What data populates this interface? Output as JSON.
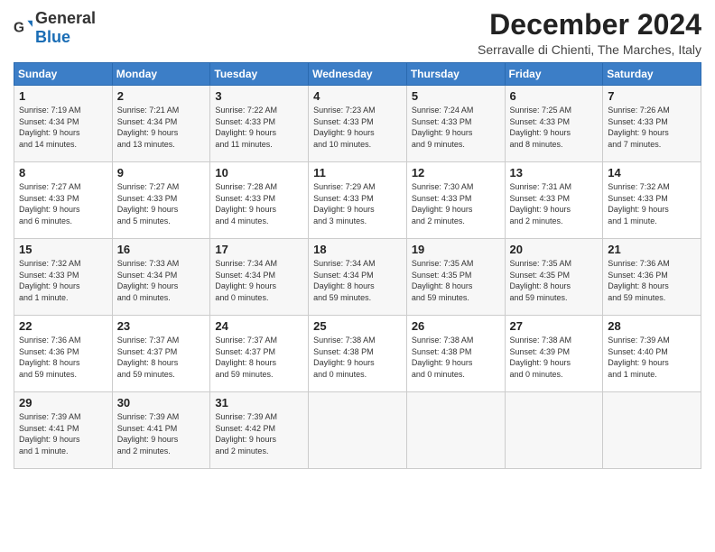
{
  "header": {
    "logo_general": "General",
    "logo_blue": "Blue",
    "title": "December 2024",
    "location": "Serravalle di Chienti, The Marches, Italy"
  },
  "days_of_week": [
    "Sunday",
    "Monday",
    "Tuesday",
    "Wednesday",
    "Thursday",
    "Friday",
    "Saturday"
  ],
  "weeks": [
    [
      {
        "day": 1,
        "info": "Sunrise: 7:19 AM\nSunset: 4:34 PM\nDaylight: 9 hours\nand 14 minutes."
      },
      {
        "day": 2,
        "info": "Sunrise: 7:21 AM\nSunset: 4:34 PM\nDaylight: 9 hours\nand 13 minutes."
      },
      {
        "day": 3,
        "info": "Sunrise: 7:22 AM\nSunset: 4:33 PM\nDaylight: 9 hours\nand 11 minutes."
      },
      {
        "day": 4,
        "info": "Sunrise: 7:23 AM\nSunset: 4:33 PM\nDaylight: 9 hours\nand 10 minutes."
      },
      {
        "day": 5,
        "info": "Sunrise: 7:24 AM\nSunset: 4:33 PM\nDaylight: 9 hours\nand 9 minutes."
      },
      {
        "day": 6,
        "info": "Sunrise: 7:25 AM\nSunset: 4:33 PM\nDaylight: 9 hours\nand 8 minutes."
      },
      {
        "day": 7,
        "info": "Sunrise: 7:26 AM\nSunset: 4:33 PM\nDaylight: 9 hours\nand 7 minutes."
      }
    ],
    [
      {
        "day": 8,
        "info": "Sunrise: 7:27 AM\nSunset: 4:33 PM\nDaylight: 9 hours\nand 6 minutes."
      },
      {
        "day": 9,
        "info": "Sunrise: 7:27 AM\nSunset: 4:33 PM\nDaylight: 9 hours\nand 5 minutes."
      },
      {
        "day": 10,
        "info": "Sunrise: 7:28 AM\nSunset: 4:33 PM\nDaylight: 9 hours\nand 4 minutes."
      },
      {
        "day": 11,
        "info": "Sunrise: 7:29 AM\nSunset: 4:33 PM\nDaylight: 9 hours\nand 3 minutes."
      },
      {
        "day": 12,
        "info": "Sunrise: 7:30 AM\nSunset: 4:33 PM\nDaylight: 9 hours\nand 2 minutes."
      },
      {
        "day": 13,
        "info": "Sunrise: 7:31 AM\nSunset: 4:33 PM\nDaylight: 9 hours\nand 2 minutes."
      },
      {
        "day": 14,
        "info": "Sunrise: 7:32 AM\nSunset: 4:33 PM\nDaylight: 9 hours\nand 1 minute."
      }
    ],
    [
      {
        "day": 15,
        "info": "Sunrise: 7:32 AM\nSunset: 4:33 PM\nDaylight: 9 hours\nand 1 minute."
      },
      {
        "day": 16,
        "info": "Sunrise: 7:33 AM\nSunset: 4:34 PM\nDaylight: 9 hours\nand 0 minutes."
      },
      {
        "day": 17,
        "info": "Sunrise: 7:34 AM\nSunset: 4:34 PM\nDaylight: 9 hours\nand 0 minutes."
      },
      {
        "day": 18,
        "info": "Sunrise: 7:34 AM\nSunset: 4:34 PM\nDaylight: 8 hours\nand 59 minutes."
      },
      {
        "day": 19,
        "info": "Sunrise: 7:35 AM\nSunset: 4:35 PM\nDaylight: 8 hours\nand 59 minutes."
      },
      {
        "day": 20,
        "info": "Sunrise: 7:35 AM\nSunset: 4:35 PM\nDaylight: 8 hours\nand 59 minutes."
      },
      {
        "day": 21,
        "info": "Sunrise: 7:36 AM\nSunset: 4:36 PM\nDaylight: 8 hours\nand 59 minutes."
      }
    ],
    [
      {
        "day": 22,
        "info": "Sunrise: 7:36 AM\nSunset: 4:36 PM\nDaylight: 8 hours\nand 59 minutes."
      },
      {
        "day": 23,
        "info": "Sunrise: 7:37 AM\nSunset: 4:37 PM\nDaylight: 8 hours\nand 59 minutes."
      },
      {
        "day": 24,
        "info": "Sunrise: 7:37 AM\nSunset: 4:37 PM\nDaylight: 8 hours\nand 59 minutes."
      },
      {
        "day": 25,
        "info": "Sunrise: 7:38 AM\nSunset: 4:38 PM\nDaylight: 9 hours\nand 0 minutes."
      },
      {
        "day": 26,
        "info": "Sunrise: 7:38 AM\nSunset: 4:38 PM\nDaylight: 9 hours\nand 0 minutes."
      },
      {
        "day": 27,
        "info": "Sunrise: 7:38 AM\nSunset: 4:39 PM\nDaylight: 9 hours\nand 0 minutes."
      },
      {
        "day": 28,
        "info": "Sunrise: 7:39 AM\nSunset: 4:40 PM\nDaylight: 9 hours\nand 1 minute."
      }
    ],
    [
      {
        "day": 29,
        "info": "Sunrise: 7:39 AM\nSunset: 4:41 PM\nDaylight: 9 hours\nand 1 minute."
      },
      {
        "day": 30,
        "info": "Sunrise: 7:39 AM\nSunset: 4:41 PM\nDaylight: 9 hours\nand 2 minutes."
      },
      {
        "day": 31,
        "info": "Sunrise: 7:39 AM\nSunset: 4:42 PM\nDaylight: 9 hours\nand 2 minutes."
      },
      null,
      null,
      null,
      null
    ]
  ]
}
